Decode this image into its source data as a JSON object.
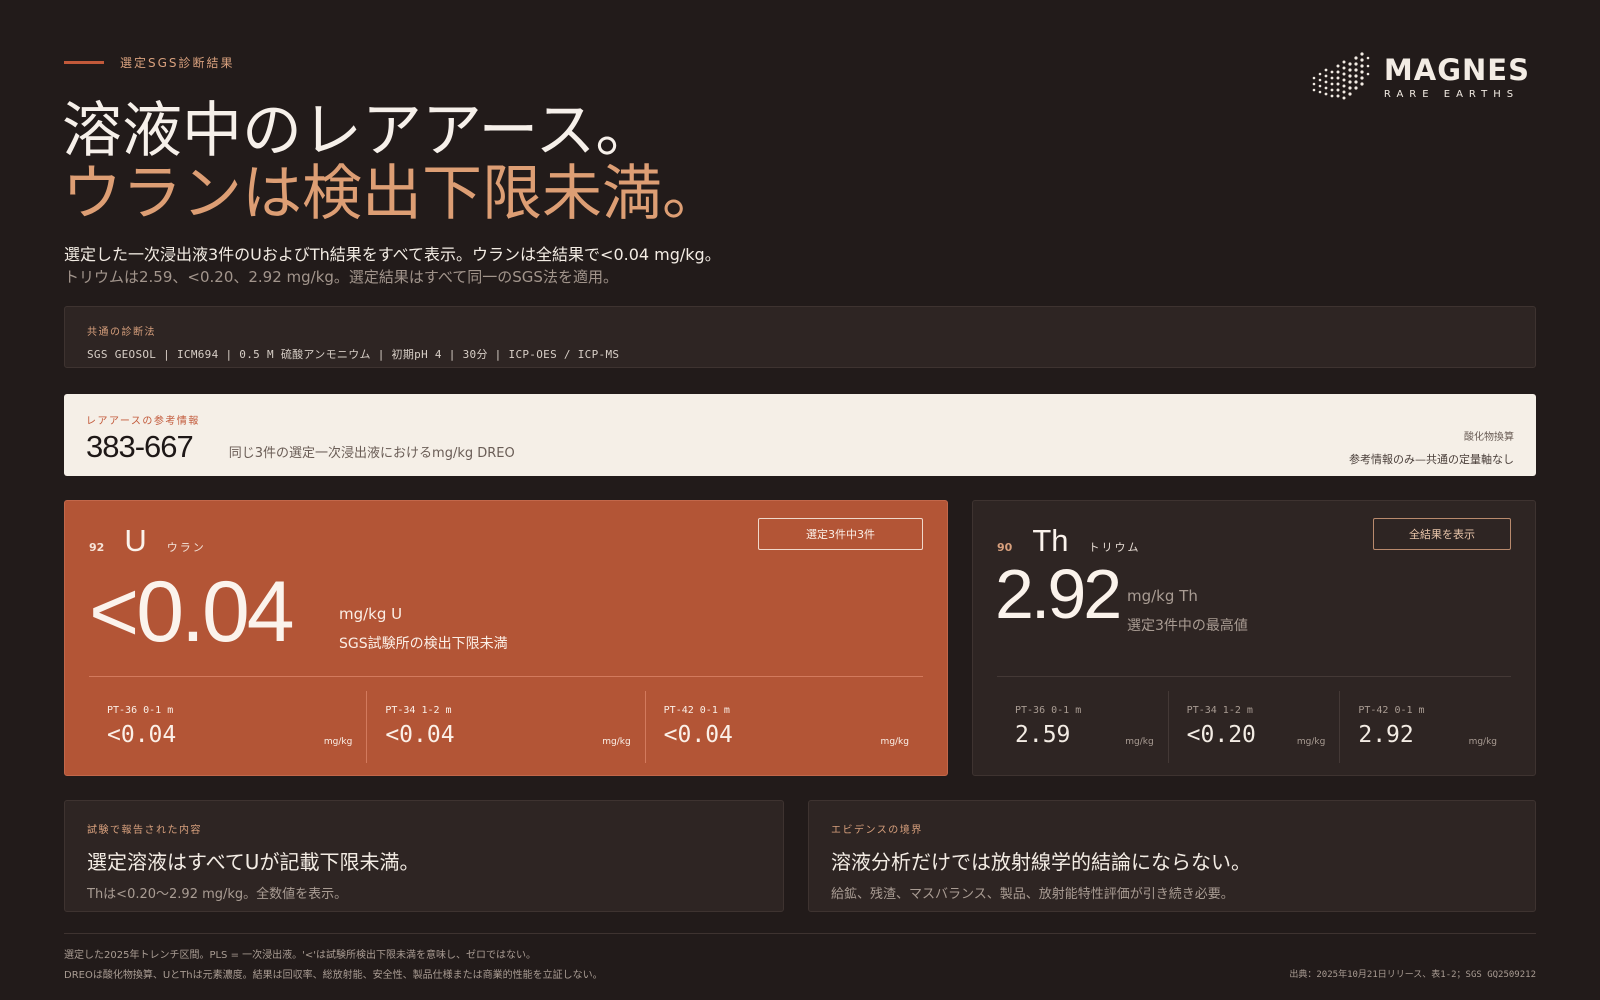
{
  "header": {
    "eyebrow": "選定SGS診断結果",
    "headline_line1": "溶液中のレアアース。",
    "headline_line2": "ウランは検出下限未満。",
    "lead_line1": "選定した一次浸出液3件のUおよびTh結果をすべて表示。ウランは全結果で<0.04 mg/kg。",
    "lead_line2": "トリウムは2.59、<0.20、2.92 mg/kg。選定結果はすべて同一のSGS法を適用。"
  },
  "logo": {
    "name": "MAGNES",
    "sub": "RARE EARTHS"
  },
  "method": {
    "label": "共通の診断法",
    "value": "SGS GEOSOL | ICM694 | 0.5 M 硫酸アンモニウム | 初期pH 4 | 30分 | ICP-OES / ICP-MS"
  },
  "ree": {
    "label": "レアアースの参考情報",
    "value": "383-667",
    "description": "同じ3件の選定一次浸出液におけるmg/kg DREO",
    "right_label": "酸化物換算",
    "right_note": "参考情報のみ—共通の定量軸なし"
  },
  "uranium": {
    "number": "92",
    "symbol": "U",
    "name": "ウラン",
    "badge": "選定3件中3件",
    "value": "<0.04",
    "unit": "mg/kg U",
    "note": "SGS試験所の検出下限未満",
    "samples": [
      {
        "label": "PT-36 0-1 m",
        "value": "<0.04",
        "unit": "mg/kg"
      },
      {
        "label": "PT-34 1-2 m",
        "value": "<0.04",
        "unit": "mg/kg"
      },
      {
        "label": "PT-42 0-1 m",
        "value": "<0.04",
        "unit": "mg/kg"
      }
    ]
  },
  "thorium": {
    "number": "90",
    "symbol": "Th",
    "name": "トリウム",
    "badge": "全結果を表示",
    "value": "2.92",
    "unit": "mg/kg Th",
    "note": "選定3件中の最高値",
    "samples": [
      {
        "label": "PT-36 0-1 m",
        "value": "2.59",
        "unit": "mg/kg"
      },
      {
        "label": "PT-34 1-2 m",
        "value": "<0.20",
        "unit": "mg/kg"
      },
      {
        "label": "PT-42 0-1 m",
        "value": "2.92",
        "unit": "mg/kg"
      }
    ]
  },
  "panels": [
    {
      "label": "試験で報告された内容",
      "title": "選定溶液はすべてUが記載下限未満。",
      "sub": "Thは<0.20～2.92 mg/kg。全数値を表示。"
    },
    {
      "label": "エビデンスの境界",
      "title": "溶液分析だけでは放射線学的結論にならない。",
      "sub": "給鉱、残渣、マスバランス、製品、放射能特性評価が引き続き必要。"
    }
  ],
  "footer": {
    "line1": "選定した2025年トレンチ区間。PLS = 一次浸出液。'<'は試験所検出下限未満を意味し、ゼロではない。",
    "line2": "DREOは酸化物換算、UとThは元素濃度。結果は回収率、総放射能、安全性、製品仕様または商業的性能を立証しない。",
    "source": "出典：2025年10月21日リリース、表1-2；SGS GQ2509212"
  },
  "colors": {
    "background": "#221b1a",
    "accent": "#c2593a",
    "uranium_card": "#b35536",
    "headline_accent": "#dd9e74"
  }
}
